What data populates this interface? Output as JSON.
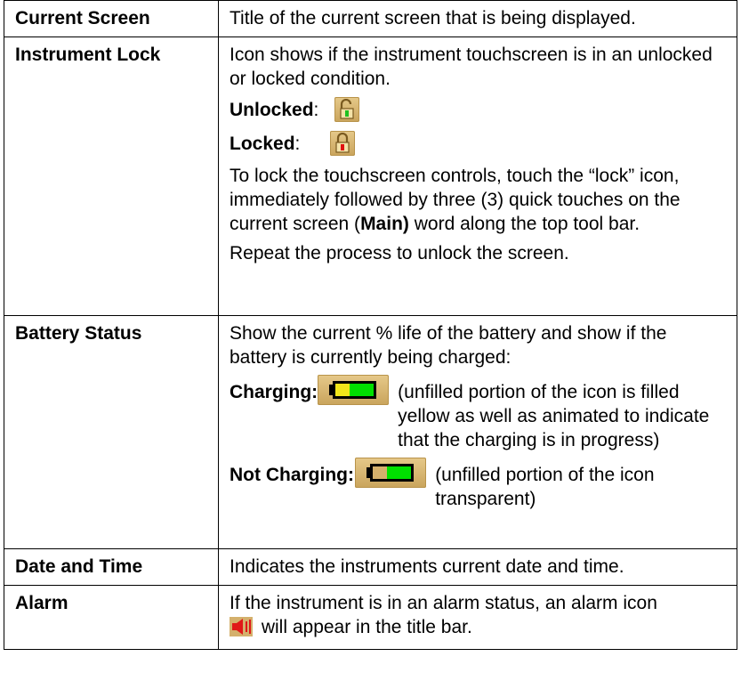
{
  "rows": [
    {
      "term": "Current Screen",
      "desc": "Title of the current screen that is being displayed."
    },
    {
      "term": "Instrument Lock",
      "intro": "Icon shows if the instrument touchscreen is in an unlocked or locked condition.",
      "unlocked_label": "Unlocked",
      "locked_label": "Locked",
      "colon": ":",
      "lock_text_1": "To lock the touchscreen controls, touch the “lock” icon, immediately followed by three (3) quick touches on the current screen (",
      "lock_text_bold": "Main)",
      "lock_text_2": " word along the top tool bar.",
      "repeat_text": "Repeat the process to unlock the screen."
    },
    {
      "term": "Battery Status",
      "intro": "Show the current % life of the battery and show if the battery is currently being charged:",
      "charging_label": "Charging:",
      "charging_desc": "(unfilled portion of the icon is filled yellow as well as animated to indicate that the charging is in progress)",
      "not_charging_label": "Not Charging:",
      "not_charging_desc": "(unfilled portion of the icon transparent)"
    },
    {
      "term": "Date and Time",
      "desc": "Indicates the instruments current date and time."
    },
    {
      "term": "Alarm",
      "desc_1": "If the instrument is in an alarm status, an alarm icon",
      "desc_2": " will appear in the title bar."
    }
  ],
  "icons": {
    "unlocked": "unlocked-padlock-icon",
    "locked": "locked-padlock-icon",
    "battery_charging": "battery-charging-icon",
    "battery": "battery-icon",
    "alarm": "alarm-speaker-icon"
  },
  "colors": {
    "icon_bg": "#d4b06c",
    "battery_green": "#00e000",
    "battery_yellow": "#f2e61a",
    "lock_red": "#e01010",
    "lock_green": "#20c020",
    "alarm_red": "#e01818"
  }
}
